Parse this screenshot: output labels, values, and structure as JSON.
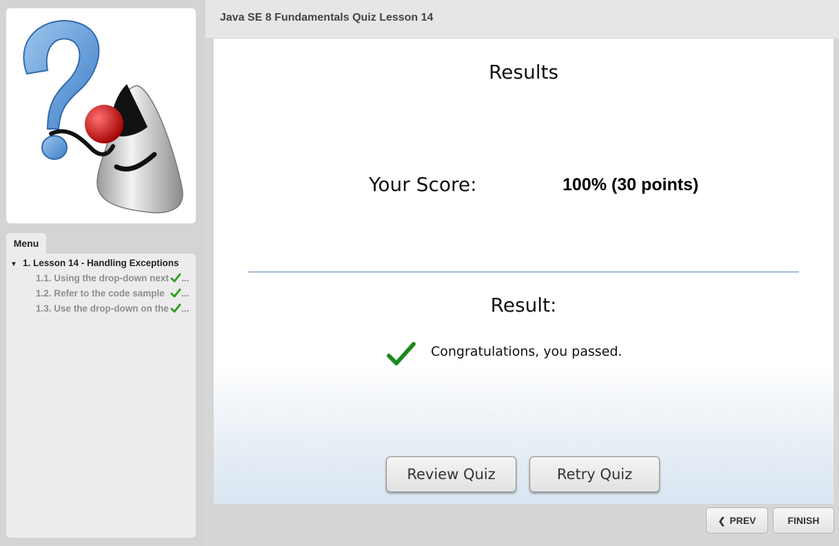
{
  "header": {
    "course_title": "Java SE 8 Fundamentals Quiz Lesson 14"
  },
  "sidebar": {
    "logo_icon": "question-mark-mascot-icon",
    "menu_tab_label": "Menu",
    "lesson": {
      "label": "1. Lesson 14 - Handling Exceptions",
      "expanded": true
    },
    "items": [
      {
        "label": "1.1. Using the drop-down next",
        "status": "completed"
      },
      {
        "label": "1.2. Refer to the code sample",
        "status": "completed"
      },
      {
        "label": "1.3. Use the drop-down on the",
        "status": "completed"
      }
    ],
    "ellipsis": "..."
  },
  "results": {
    "heading": "Results",
    "score_label": "Your Score:",
    "score_value": "100% (30 points)",
    "result_heading": "Result:",
    "message": "Congratulations, you passed.",
    "review_button": "Review Quiz",
    "retry_button": "Retry Quiz"
  },
  "footer": {
    "prev_label": "PREV",
    "finish_label": "FINISH"
  },
  "colors": {
    "check_green": "#2e9e1f",
    "divider": "#5b7fb0",
    "panel_bg": "#ececec"
  }
}
